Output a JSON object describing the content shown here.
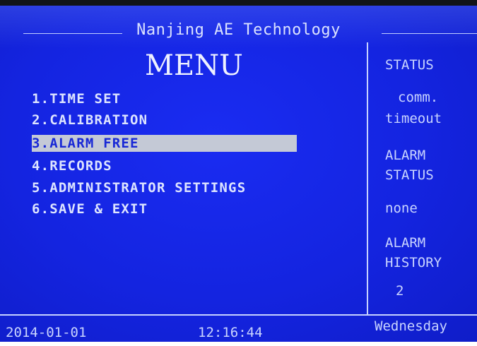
{
  "header": {
    "title": "Nanjing AE Technology"
  },
  "menu": {
    "title": "MENU",
    "items": [
      {
        "label": "1.TIME SET"
      },
      {
        "label": "2.CALIBRATION"
      },
      {
        "label": "3.ALARM FREE",
        "selected": true
      },
      {
        "label": "4.RECORDS"
      },
      {
        "label": "5.ADMINISTRATOR SETTINGS"
      },
      {
        "label": "6.SAVE & EXIT"
      }
    ]
  },
  "status_panel": {
    "status_heading": "STATUS",
    "comm_line1": "comm.",
    "comm_line2": "timeout",
    "alarm_status_line1": "ALARM",
    "alarm_status_line2": "STATUS",
    "alarm_status_value": "none",
    "alarm_history_line1": "ALARM",
    "alarm_history_line2": "HISTORY",
    "alarm_history_value": "2"
  },
  "footer": {
    "date": "2014-01-01",
    "time": "12:16:44",
    "weekday": "Wednesday"
  },
  "colors": {
    "screen_background": "#1424e0",
    "text": "#dde4ff",
    "highlight_background": "#c4c9d6"
  }
}
